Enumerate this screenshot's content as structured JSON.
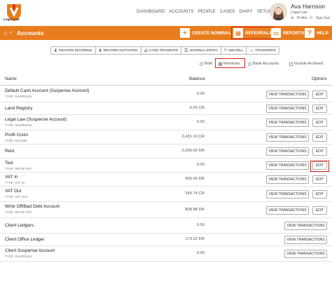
{
  "app": {
    "logo_text": "Legal Law"
  },
  "nav": [
    "DASHBOARD",
    "ACCOUNTS",
    "PEOPLE",
    "CASES",
    "DIARY",
    "SETUP"
  ],
  "user": {
    "name": "Ava Harrison",
    "role": "Legal Law",
    "links": [
      "Profile",
      "Sign Out"
    ]
  },
  "page": {
    "title": "Accounts"
  },
  "actions": {
    "create": "CREATE NOMINAL",
    "referrals": "REFERRALS",
    "reports": "REPORTS",
    "help": "HELP"
  },
  "toolbar": [
    "RECORD INCOMING",
    "RECORD OUTGOING",
    "CASH TRANSFER",
    "JOURNAL ENTRY",
    "ADD BILL",
    "TRANSFERS"
  ],
  "filters": {
    "both": "Both",
    "nominals": "Nominals",
    "bank": "Bank Accounts",
    "archived": "Include Archived",
    "selected": "Nominals"
  },
  "table": {
    "headers": {
      "name": "Name",
      "balance": "Balance",
      "options": "Options"
    },
    "view_label": "VIEW TRANSACTIONS",
    "edit_label": "EDIT",
    "rows": [
      {
        "name": "Default Cash Account (Suspense Account)",
        "type": "TYPE: SUSPENSE",
        "balance": "0.00"
      },
      {
        "name": "Land Registry",
        "type": "",
        "balance": "6.00 CR"
      },
      {
        "name": "Legal Law (Suspense Account)",
        "type": "TYPE: SUSPENSE",
        "balance": "0.00"
      },
      {
        "name": "Profit Costs",
        "type": "TYPE: INCOME",
        "balance": "2,431.10 CR"
      },
      {
        "name": "Rent",
        "type": "",
        "balance": "2,000.00 DR"
      },
      {
        "name": "Test",
        "type": "TYPE: WRITE OFF",
        "balance": "0.00"
      },
      {
        "name": "VAT In",
        "type": "TYPE: VAT IN",
        "balance": "400.00 DR"
      },
      {
        "name": "VAT Out",
        "type": "TYPE: VAT OUT",
        "balance": "340.74 CR"
      },
      {
        "name": "Write Off/Bad Debt Account",
        "type": "TYPE: WRITE OFF",
        "balance": "808.88 DR"
      },
      {
        "name": "Client Ledgers",
        "type": "",
        "balance": "0.00"
      },
      {
        "name": "Client Office Ledger",
        "type": "",
        "balance": "173.22 DR"
      },
      {
        "name": "Client Suspense Account",
        "type": "TYPE: SUSPENSE",
        "balance": "0.00"
      }
    ]
  },
  "colors": {
    "accent": "#e87d1e",
    "highlight": "#d9251c"
  }
}
